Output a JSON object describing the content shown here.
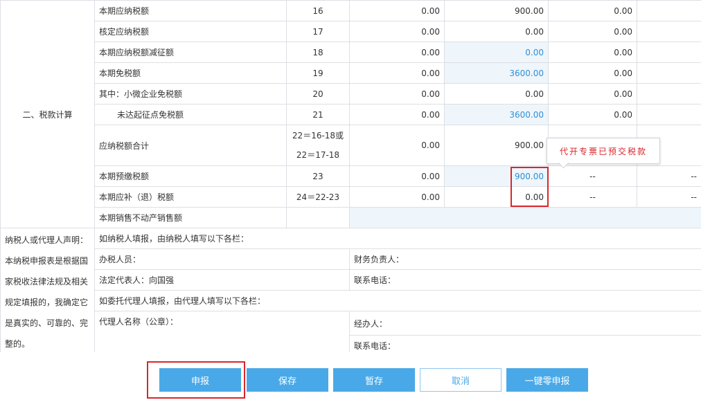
{
  "section": {
    "title": "二、税款计算"
  },
  "rows": [
    {
      "label": "本期应纳税额",
      "line": "16",
      "c1": "0.00",
      "c2": "900.00",
      "c3": "0.00",
      "c4": ""
    },
    {
      "label": "核定应纳税额",
      "line": "17",
      "c1": "0.00",
      "c2": "0.00",
      "c3": "0.00",
      "c4": ""
    },
    {
      "label": "本期应纳税额减征额",
      "line": "18",
      "c1": "0.00",
      "c2": "0.00",
      "c3": "0.00",
      "c4": ""
    },
    {
      "label": "本期免税额",
      "line": "19",
      "c1": "0.00",
      "c2": "3600.00",
      "c3": "0.00",
      "c4": ""
    },
    {
      "label": "其中：小微企业免税额",
      "line": "20",
      "c1": "0.00",
      "c2": "0.00",
      "c3": "0.00",
      "c4": ""
    },
    {
      "label": "未达起征点免税额",
      "line": "21",
      "c1": "0.00",
      "c2": "3600.00",
      "c3": "0.00",
      "c4": ""
    },
    {
      "label": "应纳税额合计",
      "line_a": "22＝16-18或",
      "line_b": "22＝17-18",
      "c1": "0.00",
      "c2": "900.00"
    },
    {
      "label": "本期预缴税额",
      "line": "23",
      "c1": "0.00",
      "c2": "900.00",
      "c3": "--",
      "c4": "--"
    },
    {
      "label": "本期应补（退）税额",
      "line": "24＝22-23",
      "c1": "0.00",
      "c2": "0.00",
      "c3": "--",
      "c4": "--"
    },
    {
      "label": "本期销售不动产销售额"
    }
  ],
  "declaration": {
    "left_title": "纳税人或代理人声明：",
    "left_body": "本纳税申报表是根据国家税收法律法规及相关规定填报的，我确定它是真实的、可靠的、完整的。",
    "taxpayer_fill": "如纳税人填报，由纳税人填写以下各栏：",
    "tax_officer": "办税人员：",
    "finance_head": "财务负责人：",
    "legal_rep": "法定代表人：向国强",
    "contact_phone_1": "联系电话：",
    "agent_fill": "如委托代理人填报，由代理人填写以下各栏：",
    "agent_name": "代理人名称（公章）：",
    "handler": "经办人：",
    "contact_phone_2": "联系电话："
  },
  "tooltip": {
    "text": "代开专票已预交税款"
  },
  "buttons": {
    "submit": "申报",
    "save": "保存",
    "temp_save": "暂存",
    "cancel": "取消",
    "zero_submit": "一键零申报"
  }
}
